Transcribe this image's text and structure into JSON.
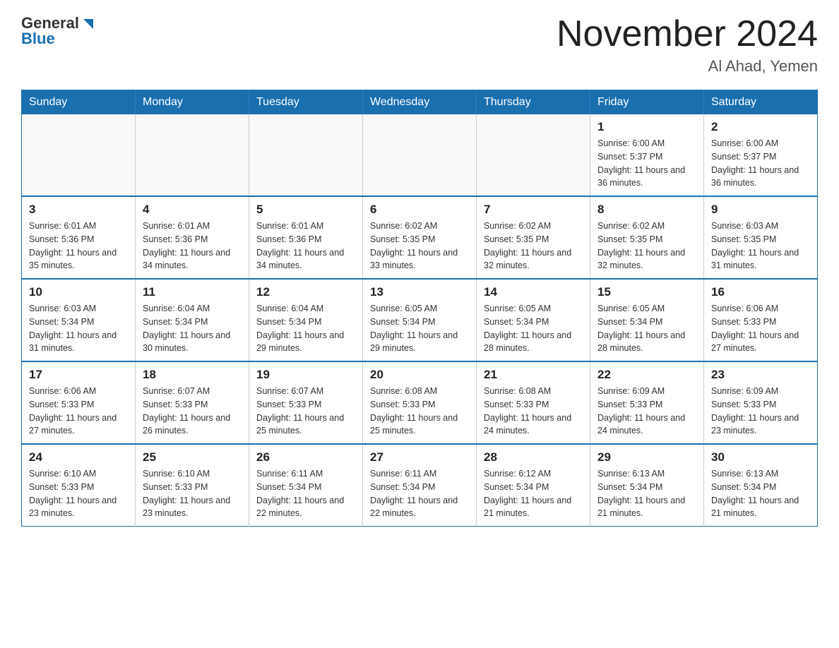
{
  "header": {
    "logo": {
      "text_general": "General",
      "text_blue": "Blue",
      "arrow_symbol": "▶"
    },
    "title": "November 2024",
    "location": "Al Ahad, Yemen"
  },
  "calendar": {
    "days_of_week": [
      "Sunday",
      "Monday",
      "Tuesday",
      "Wednesday",
      "Thursday",
      "Friday",
      "Saturday"
    ],
    "weeks": [
      [
        {
          "day": "",
          "info": ""
        },
        {
          "day": "",
          "info": ""
        },
        {
          "day": "",
          "info": ""
        },
        {
          "day": "",
          "info": ""
        },
        {
          "day": "",
          "info": ""
        },
        {
          "day": "1",
          "info": "Sunrise: 6:00 AM\nSunset: 5:37 PM\nDaylight: 11 hours and 36 minutes."
        },
        {
          "day": "2",
          "info": "Sunrise: 6:00 AM\nSunset: 5:37 PM\nDaylight: 11 hours and 36 minutes."
        }
      ],
      [
        {
          "day": "3",
          "info": "Sunrise: 6:01 AM\nSunset: 5:36 PM\nDaylight: 11 hours and 35 minutes."
        },
        {
          "day": "4",
          "info": "Sunrise: 6:01 AM\nSunset: 5:36 PM\nDaylight: 11 hours and 34 minutes."
        },
        {
          "day": "5",
          "info": "Sunrise: 6:01 AM\nSunset: 5:36 PM\nDaylight: 11 hours and 34 minutes."
        },
        {
          "day": "6",
          "info": "Sunrise: 6:02 AM\nSunset: 5:35 PM\nDaylight: 11 hours and 33 minutes."
        },
        {
          "day": "7",
          "info": "Sunrise: 6:02 AM\nSunset: 5:35 PM\nDaylight: 11 hours and 32 minutes."
        },
        {
          "day": "8",
          "info": "Sunrise: 6:02 AM\nSunset: 5:35 PM\nDaylight: 11 hours and 32 minutes."
        },
        {
          "day": "9",
          "info": "Sunrise: 6:03 AM\nSunset: 5:35 PM\nDaylight: 11 hours and 31 minutes."
        }
      ],
      [
        {
          "day": "10",
          "info": "Sunrise: 6:03 AM\nSunset: 5:34 PM\nDaylight: 11 hours and 31 minutes."
        },
        {
          "day": "11",
          "info": "Sunrise: 6:04 AM\nSunset: 5:34 PM\nDaylight: 11 hours and 30 minutes."
        },
        {
          "day": "12",
          "info": "Sunrise: 6:04 AM\nSunset: 5:34 PM\nDaylight: 11 hours and 29 minutes."
        },
        {
          "day": "13",
          "info": "Sunrise: 6:05 AM\nSunset: 5:34 PM\nDaylight: 11 hours and 29 minutes."
        },
        {
          "day": "14",
          "info": "Sunrise: 6:05 AM\nSunset: 5:34 PM\nDaylight: 11 hours and 28 minutes."
        },
        {
          "day": "15",
          "info": "Sunrise: 6:05 AM\nSunset: 5:34 PM\nDaylight: 11 hours and 28 minutes."
        },
        {
          "day": "16",
          "info": "Sunrise: 6:06 AM\nSunset: 5:33 PM\nDaylight: 11 hours and 27 minutes."
        }
      ],
      [
        {
          "day": "17",
          "info": "Sunrise: 6:06 AM\nSunset: 5:33 PM\nDaylight: 11 hours and 27 minutes."
        },
        {
          "day": "18",
          "info": "Sunrise: 6:07 AM\nSunset: 5:33 PM\nDaylight: 11 hours and 26 minutes."
        },
        {
          "day": "19",
          "info": "Sunrise: 6:07 AM\nSunset: 5:33 PM\nDaylight: 11 hours and 25 minutes."
        },
        {
          "day": "20",
          "info": "Sunrise: 6:08 AM\nSunset: 5:33 PM\nDaylight: 11 hours and 25 minutes."
        },
        {
          "day": "21",
          "info": "Sunrise: 6:08 AM\nSunset: 5:33 PM\nDaylight: 11 hours and 24 minutes."
        },
        {
          "day": "22",
          "info": "Sunrise: 6:09 AM\nSunset: 5:33 PM\nDaylight: 11 hours and 24 minutes."
        },
        {
          "day": "23",
          "info": "Sunrise: 6:09 AM\nSunset: 5:33 PM\nDaylight: 11 hours and 23 minutes."
        }
      ],
      [
        {
          "day": "24",
          "info": "Sunrise: 6:10 AM\nSunset: 5:33 PM\nDaylight: 11 hours and 23 minutes."
        },
        {
          "day": "25",
          "info": "Sunrise: 6:10 AM\nSunset: 5:33 PM\nDaylight: 11 hours and 23 minutes."
        },
        {
          "day": "26",
          "info": "Sunrise: 6:11 AM\nSunset: 5:34 PM\nDaylight: 11 hours and 22 minutes."
        },
        {
          "day": "27",
          "info": "Sunrise: 6:11 AM\nSunset: 5:34 PM\nDaylight: 11 hours and 22 minutes."
        },
        {
          "day": "28",
          "info": "Sunrise: 6:12 AM\nSunset: 5:34 PM\nDaylight: 11 hours and 21 minutes."
        },
        {
          "day": "29",
          "info": "Sunrise: 6:13 AM\nSunset: 5:34 PM\nDaylight: 11 hours and 21 minutes."
        },
        {
          "day": "30",
          "info": "Sunrise: 6:13 AM\nSunset: 5:34 PM\nDaylight: 11 hours and 21 minutes."
        }
      ]
    ]
  }
}
